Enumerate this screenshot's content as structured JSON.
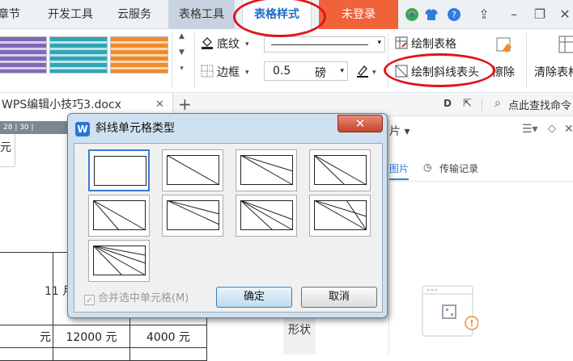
{
  "menubar": {
    "items": [
      "章节",
      "开发工具",
      "云服务"
    ],
    "tools_tab": "表格工具",
    "active_tab": "表格样式",
    "login": "未登录"
  },
  "ribbon": {
    "shading": "底纹",
    "border": "边框",
    "line_width_value": "0.5",
    "line_width_unit": "磅",
    "draw_table": "绘制表格",
    "draw_diagonal_header": "绘制斜线表头",
    "erase": "擦除",
    "clear_table": "清除表格"
  },
  "tabbar": {
    "doc_name": "WPS编辑小技巧3.docx",
    "search_placeholder": "点此查找命令"
  },
  "ruler": {
    "marks": "28 | 30 |"
  },
  "document": {
    "cells": [
      "11 月",
      "元",
      "12000 元",
      "4000 元"
    ]
  },
  "side_panel": {
    "title": "片",
    "tab_images": "图片",
    "tab_transfer": "传输记录",
    "shape_label": "形状"
  },
  "dialog": {
    "title": "斜线单元格类型",
    "merge_checkbox": "合并选中单元格(M)",
    "ok": "确定",
    "cancel": "取消"
  },
  "colors": {
    "accent": "#1a6cc9",
    "login_bg": "#f0623a",
    "annotation": "#e0141e"
  }
}
